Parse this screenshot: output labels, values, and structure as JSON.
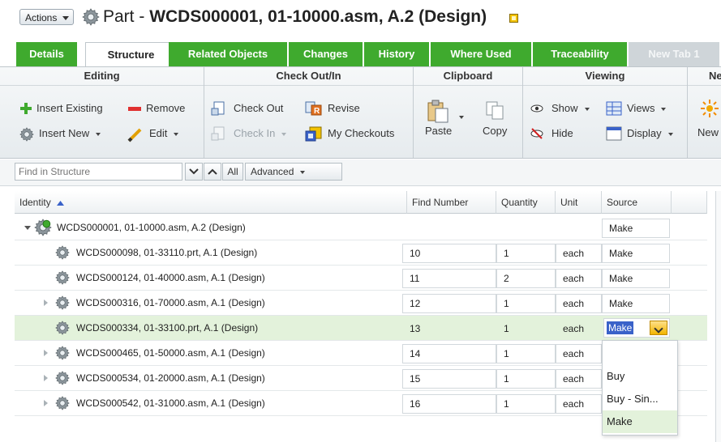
{
  "header": {
    "actions_label": "Actions",
    "title_prefix": "Part - ",
    "title_name": "WCDS000001, 01-10000.asm, A.2 (Design)"
  },
  "tabs": [
    {
      "label": "Details"
    },
    {
      "label": "Structure"
    },
    {
      "label": "Related Objects"
    },
    {
      "label": "Changes"
    },
    {
      "label": "History"
    },
    {
      "label": "Where Used"
    },
    {
      "label": "Traceability"
    },
    {
      "label": "New Tab 1"
    }
  ],
  "ribbon": {
    "editing": {
      "title": "Editing",
      "insert_existing": "Insert Existing",
      "remove": "Remove",
      "insert_new": "Insert New",
      "edit": "Edit"
    },
    "checkout": {
      "title": "Check Out/In",
      "check_out": "Check Out",
      "revise": "Revise",
      "check_in": "Check In",
      "my_checkouts": "My Checkouts"
    },
    "clipboard": {
      "title": "Clipboard",
      "paste": "Paste",
      "copy": "Copy"
    },
    "viewing": {
      "title": "Viewing",
      "show": "Show",
      "views": "Views",
      "hide": "Hide",
      "display": "Display"
    },
    "new": {
      "title": "Ne",
      "new_label": "New"
    }
  },
  "findbar": {
    "placeholder": "Find in Structure",
    "all": "All",
    "advanced": "Advanced"
  },
  "table": {
    "columns": {
      "identity": "Identity",
      "find_number": "Find Number",
      "quantity": "Quantity",
      "unit": "Unit",
      "source": "Source"
    },
    "rows": [
      {
        "identity": "WCDS000001, 01-10000.asm, A.2 (Design)",
        "find": "",
        "qty": "",
        "unit": "",
        "source": "Make"
      },
      {
        "identity": "WCDS000098, 01-33110.prt, A.1 (Design)",
        "find": "10",
        "qty": "1",
        "unit": "each",
        "source": "Make"
      },
      {
        "identity": "WCDS000124, 01-40000.asm, A.1 (Design)",
        "find": "11",
        "qty": "2",
        "unit": "each",
        "source": "Make"
      },
      {
        "identity": "WCDS000316, 01-70000.asm, A.1 (Design)",
        "find": "12",
        "qty": "1",
        "unit": "each",
        "source": "Make"
      },
      {
        "identity": "WCDS000334, 01-33100.prt, A.1 (Design)",
        "find": "13",
        "qty": "1",
        "unit": "each",
        "source": "Make"
      },
      {
        "identity": "WCDS000465, 01-50000.asm, A.1 (Design)",
        "find": "14",
        "qty": "1",
        "unit": "each",
        "source": ""
      },
      {
        "identity": "WCDS000534, 01-20000.asm, A.1 (Design)",
        "find": "15",
        "qty": "1",
        "unit": "each",
        "source": ""
      },
      {
        "identity": "WCDS000542, 01-31000.asm, A.1 (Design)",
        "find": "16",
        "qty": "1",
        "unit": "each",
        "source": ""
      }
    ]
  },
  "source_editor": {
    "value": "Make"
  },
  "source_options": [
    "",
    "Buy",
    "Buy - Sin...",
    "Make"
  ],
  "colors": {
    "tab_green": "#3faa2e",
    "selection": "#e3f2db",
    "highlight_blue": "#3a62c9"
  }
}
